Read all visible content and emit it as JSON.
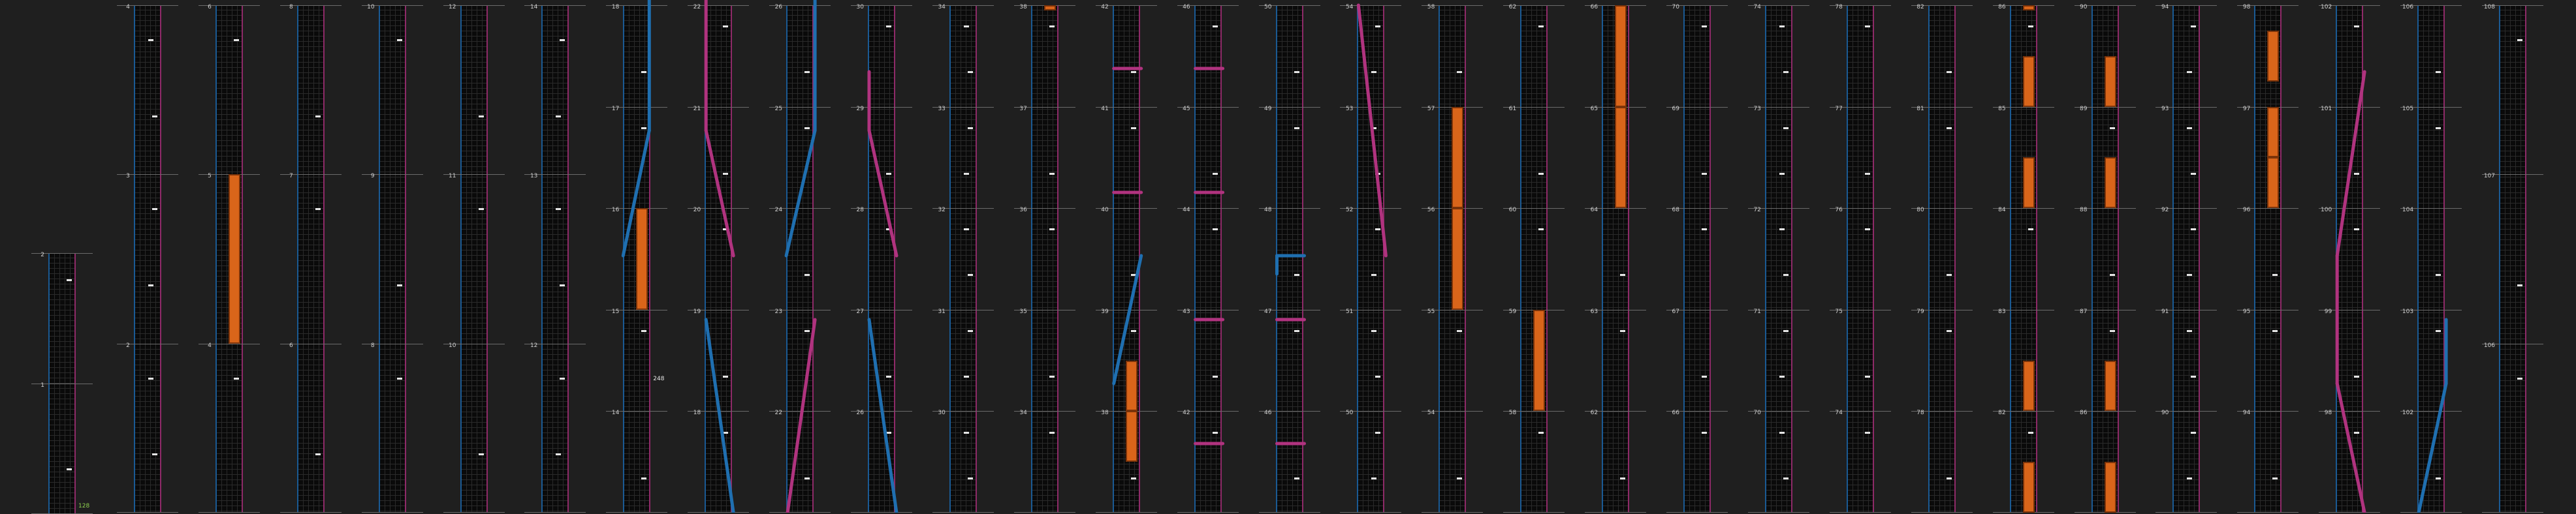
{
  "grid": {
    "columns": [
      {
        "cells": [
          "2",
          "1"
        ],
        "badge": "128"
      },
      {
        "cells": [
          "4",
          "3",
          "2"
        ]
      },
      {
        "cells": [
          "6",
          "5",
          "4"
        ]
      },
      {
        "cells": [
          "8",
          "7",
          "6"
        ]
      },
      {
        "cells": [
          "10",
          "9",
          "8"
        ]
      },
      {
        "cells": [
          "12",
          "11",
          "10"
        ]
      },
      {
        "cells": [
          "14",
          "13",
          "12"
        ]
      },
      {
        "cells": [
          "18",
          "17",
          "16",
          "15",
          "14"
        ],
        "badge": "248"
      },
      {
        "cells": [
          "22",
          "21",
          "20",
          "19",
          "18"
        ]
      },
      {
        "cells": [
          "26",
          "25",
          "24",
          "23",
          "22"
        ]
      },
      {
        "cells": [
          "30",
          "29",
          "28",
          "27",
          "26"
        ]
      },
      {
        "cells": [
          "34",
          "33",
          "32",
          "31",
          "30"
        ]
      },
      {
        "cells": [
          "38",
          "37",
          "36",
          "35",
          "34"
        ]
      },
      {
        "cells": [
          "42",
          "41",
          "40",
          "39",
          "38"
        ]
      },
      {
        "cells": [
          "46",
          "45",
          "44",
          "43",
          "42"
        ]
      },
      {
        "cells": [
          "50",
          "49",
          "48",
          "47",
          "46"
        ]
      },
      {
        "cells": [
          "54",
          "53",
          "52",
          "51",
          "50"
        ]
      },
      {
        "cells": [
          "58",
          "57",
          "56",
          "55",
          "54"
        ]
      },
      {
        "cells": [
          "62",
          "61",
          "60",
          "59",
          "58"
        ]
      },
      {
        "cells": [
          "66",
          "65",
          "64",
          "63",
          "62"
        ]
      },
      {
        "cells": [
          "70",
          "69",
          "68",
          "67",
          "66"
        ]
      },
      {
        "cells": [
          "74",
          "73",
          "72",
          "71",
          "70"
        ]
      },
      {
        "cells": [
          "78",
          "77",
          "76",
          "75",
          "74"
        ]
      },
      {
        "cells": [
          "82",
          "81",
          "80",
          "79",
          "78"
        ]
      },
      {
        "cells": [
          "86",
          "85",
          "84",
          "83",
          "82"
        ]
      },
      {
        "cells": [
          "90",
          "89",
          "88",
          "87",
          "86"
        ]
      },
      {
        "cells": [
          "94",
          "93",
          "92",
          "91",
          "90"
        ]
      },
      {
        "cells": [
          "98",
          "97",
          "96",
          "95",
          "94"
        ]
      },
      {
        "cells": [
          "102",
          "101",
          "100",
          "99",
          "98"
        ]
      },
      {
        "cells": [
          "106",
          "105",
          "104",
          "103",
          "102"
        ]
      },
      {
        "cells": [
          "108",
          "107",
          "106"
        ]
      }
    ],
    "colors": {
      "background": "#1f1f1f",
      "panel": "#0a0a0a",
      "blue": "#1f6fb0",
      "magenta": "#b0337f",
      "orange": "#d9651a",
      "badge": "#8fd14f"
    }
  }
}
